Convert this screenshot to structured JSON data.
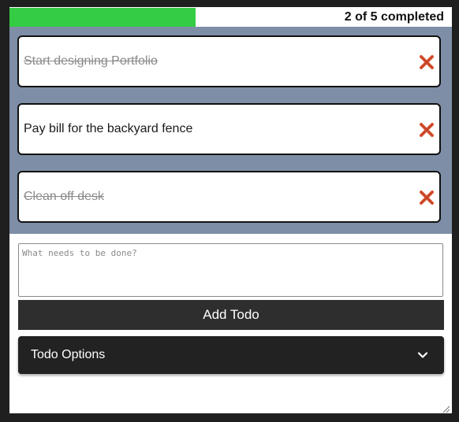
{
  "progress": {
    "completed": 2,
    "total": 5,
    "fraction": 0.42,
    "label": "2 of 5 completed",
    "color": "#33cc44"
  },
  "todos": [
    {
      "text": "Start designing Portfolio",
      "done": true
    },
    {
      "text": "Pay bill for the backyard fence",
      "done": false
    },
    {
      "text": "Clean off desk",
      "done": true
    }
  ],
  "icons": {
    "delete": "close-x-icon",
    "options_toggle": "chevron-down-icon",
    "resize": "resize-grip-icon"
  },
  "colors": {
    "delete": "#d8502f",
    "panel": "#7d8ea6",
    "button": "#2e2e2e"
  },
  "form": {
    "placeholder": "What needs to be done?",
    "add_label": "Add Todo"
  },
  "options": {
    "label": "Todo Options"
  }
}
